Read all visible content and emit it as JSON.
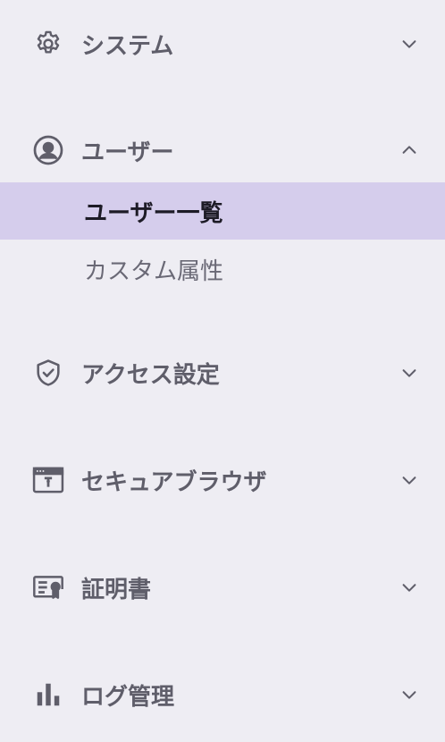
{
  "sections": [
    {
      "label": "システム",
      "icon": "gear-icon",
      "expanded": false
    },
    {
      "label": "ユーザー",
      "icon": "user-circle-icon",
      "expanded": true,
      "items": [
        {
          "label": "ユーザー一覧",
          "active": true
        },
        {
          "label": "カスタム属性",
          "active": false
        }
      ]
    },
    {
      "label": "アクセス設定",
      "icon": "shield-check-icon",
      "expanded": false
    },
    {
      "label": "セキュアブラウザ",
      "icon": "browser-window-icon",
      "expanded": false
    },
    {
      "label": "証明書",
      "icon": "certificate-icon",
      "expanded": false
    },
    {
      "label": "ログ管理",
      "icon": "bar-chart-icon",
      "expanded": false
    }
  ],
  "colors": {
    "background": "#eeedf3",
    "active_background": "#d5cdec",
    "text": "#5f5e6a",
    "active_text": "#1d1b26"
  }
}
